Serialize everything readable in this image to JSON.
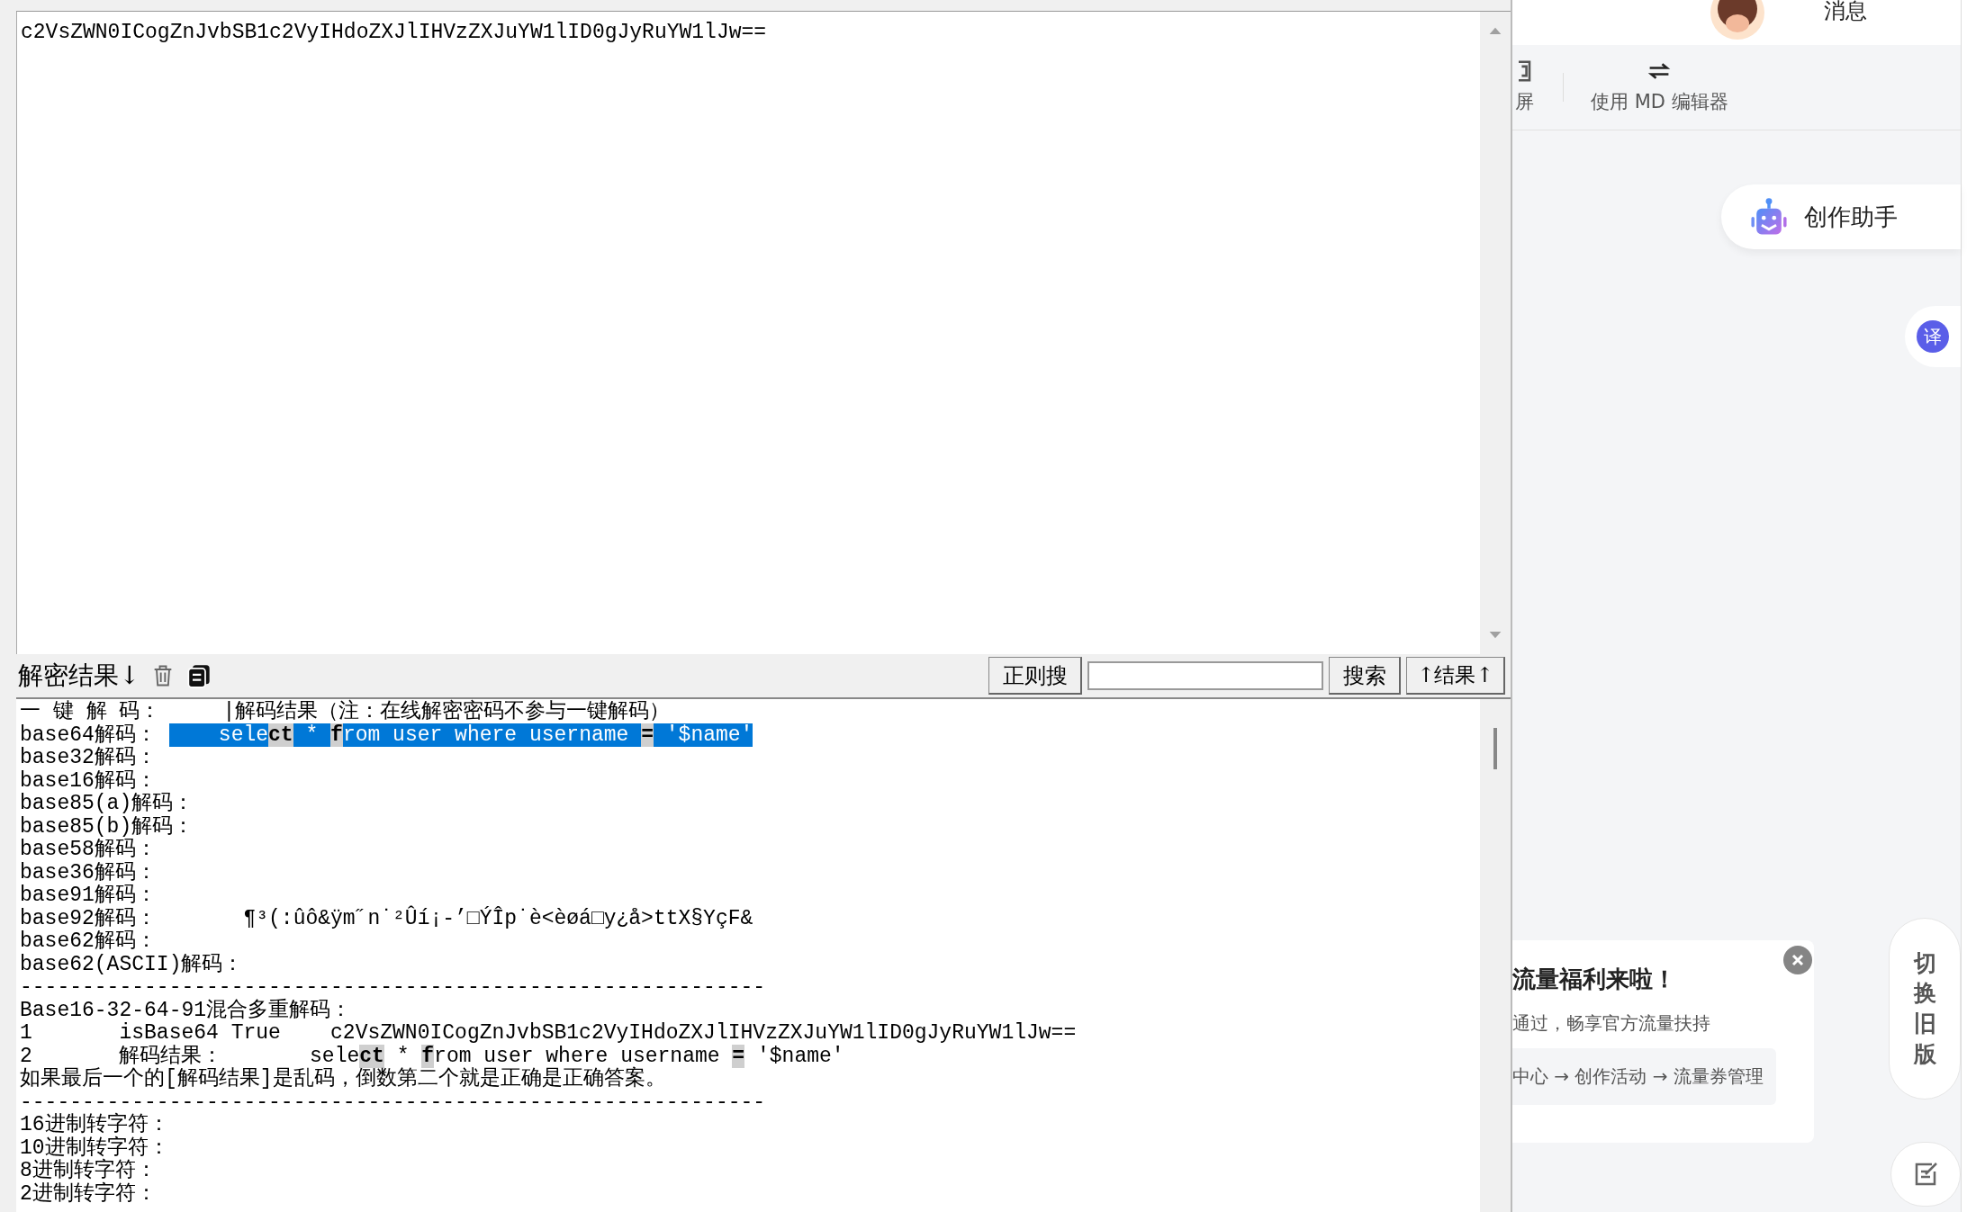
{
  "decoder": {
    "input_box": {
      "value": "c2VsZWN0ICogZnJvbSB1c2VyIHdoZXJlIHVzZXJuYW1lID0gJyRuYW1lJw=="
    },
    "result_toolbar": {
      "title": "解密结果↓",
      "regex_button": "正则搜",
      "search_button": "搜索",
      "results_button": "↑结果↑"
    },
    "output_lines": [
      {
        "segments": [
          {
            "kind": "plain",
            "text": "一 键 解 码：     |解码结果（注：在线解密密码不参与一键解码）"
          }
        ]
      },
      {
        "segments": [
          {
            "kind": "plain",
            "text": "base64解码： "
          },
          {
            "kind": "selected",
            "text": "    sele"
          },
          {
            "kind": "match",
            "text": "ct"
          },
          {
            "kind": "selected",
            "text": " * "
          },
          {
            "kind": "match",
            "text": "f"
          },
          {
            "kind": "selected",
            "text": "rom user where username "
          },
          {
            "kind": "match",
            "text": "="
          },
          {
            "kind": "selected",
            "text": " '$name'"
          }
        ]
      },
      {
        "segments": [
          {
            "kind": "plain",
            "text": "base32解码："
          }
        ]
      },
      {
        "segments": [
          {
            "kind": "plain",
            "text": "base16解码："
          }
        ]
      },
      {
        "segments": [
          {
            "kind": "plain",
            "text": "base85(a)解码："
          }
        ]
      },
      {
        "segments": [
          {
            "kind": "plain",
            "text": "base85(b)解码："
          }
        ]
      },
      {
        "segments": [
          {
            "kind": "plain",
            "text": "base58解码："
          }
        ]
      },
      {
        "segments": [
          {
            "kind": "plain",
            "text": "base36解码："
          }
        ]
      },
      {
        "segments": [
          {
            "kind": "plain",
            "text": "base91解码："
          }
        ]
      },
      {
        "segments": [
          {
            "kind": "plain",
            "text": "base92解码：       ¶³(:ûô&ÿm˝n˙²Ûí¡-’□ÝÎp˙è<èøá□y¿å>ttX§YçF&"
          }
        ]
      },
      {
        "segments": [
          {
            "kind": "plain",
            "text": "base62解码："
          }
        ]
      },
      {
        "segments": [
          {
            "kind": "plain",
            "text": "base62(ASCII)解码："
          }
        ]
      },
      {
        "segments": [
          {
            "kind": "plain",
            "text": "------------------------------------------------------------"
          }
        ]
      },
      {
        "segments": [
          {
            "kind": "plain",
            "text": "Base16-32-64-91混合多重解码："
          }
        ]
      },
      {
        "segments": [
          {
            "kind": "plain",
            "text": "1       isBase64 True    c2VsZWN0ICogZnJvbSB1c2VyIHdoZXJlIHVzZXJuYW1lID0gJyRuYW1lJw=="
          }
        ]
      },
      {
        "segments": [
          {
            "kind": "plain",
            "text": "2       解码结果：       sele"
          },
          {
            "kind": "match",
            "text": "ct"
          },
          {
            "kind": "plain",
            "text": " * "
          },
          {
            "kind": "match",
            "text": "f"
          },
          {
            "kind": "plain",
            "text": "rom user where username "
          },
          {
            "kind": "match",
            "text": "="
          },
          {
            "kind": "plain",
            "text": " '$name'"
          }
        ]
      },
      {
        "segments": [
          {
            "kind": "plain",
            "text": "如果最后一个的[解码结果]是乱码，倒数第二个就是正确是正确答案。"
          }
        ]
      },
      {
        "segments": [
          {
            "kind": "plain",
            "text": "------------------------------------------------------------"
          }
        ]
      },
      {
        "segments": [
          {
            "kind": "plain",
            "text": "16进制转字符："
          }
        ]
      },
      {
        "segments": [
          {
            "kind": "plain",
            "text": "10进制转字符："
          }
        ]
      },
      {
        "segments": [
          {
            "kind": "plain",
            "text": "8进制转字符："
          }
        ]
      },
      {
        "segments": [
          {
            "kind": "plain",
            "text": "2进制转字符："
          }
        ]
      }
    ]
  },
  "editor_page": {
    "header": {
      "messages_label": "消息"
    },
    "toolbar": [
      {
        "kind": "screen",
        "label": "屏"
      },
      {
        "kind": "switch",
        "label": "使用 MD 编辑器"
      }
    ],
    "assistant_button": "创作助手",
    "translate_button": "译",
    "promo_card": {
      "title": "流量福利来啦！",
      "text": "通过，畅享官方流量扶持",
      "path": "中心 → 创作活动 → 流量券管理"
    },
    "old_version_button": "切换旧版"
  }
}
